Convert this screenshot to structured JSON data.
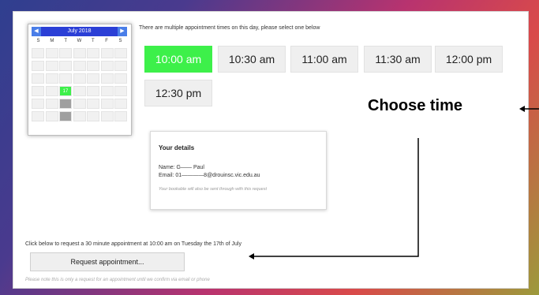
{
  "calendar": {
    "month_label": "July 2018",
    "prev_icon": "◀",
    "next_icon": "▶",
    "weekdays": [
      "S",
      "M",
      "T",
      "W",
      "T",
      "F",
      "S"
    ],
    "selected_day": "17"
  },
  "instruction": "There are multiple appointment times on this day, please select one below",
  "times": [
    "10:00 am",
    "10:30 am",
    "11:00 am",
    "11:30 am",
    "12:00 pm",
    "12:30 pm"
  ],
  "selected_time": "10:00 am",
  "details": {
    "title": "Your details",
    "name_line": "Name: G—— Paul",
    "email_line": "Email: 01————8@drouinsc.vic.edu.au",
    "note": "Your bookable will also be sent through with this request"
  },
  "annotation": {
    "label": "Choose time"
  },
  "request": {
    "text": "Click below to request a 30 minute appointment at 10:00 am on Tuesday the 17th of July",
    "button_label": "Request appointment...",
    "footnote": "Please note this is only a request for an appointment until we confirm via email or phone"
  },
  "colors": {
    "selected_green": "#3df04a",
    "calendar_header": "#2b3fd6"
  }
}
